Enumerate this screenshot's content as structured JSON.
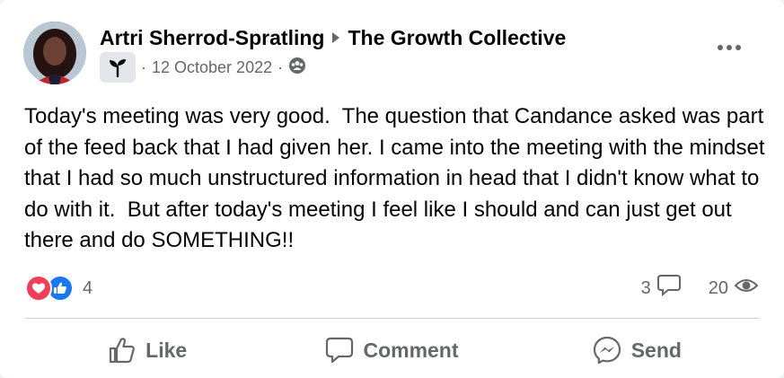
{
  "post": {
    "author": "Artri Sherrod-Spratling",
    "group": "The Growth Collective",
    "date": "12 October 2022",
    "body": "Today's meeting was very good.  The question that Candance asked was part of the feed back that I had given her. I came into the meeting with the mindset that I had so much unstructured information in head that I didn't know what to do with it.  But after today's meeting I feel like I should and can just get out there and do SOMETHING!!",
    "icons": {
      "more": "more-options-icon",
      "group": "sprout-icon",
      "audience": "group-audience-icon",
      "separator": "triangle-right-icon"
    }
  },
  "engagement": {
    "reactions_count": "4",
    "reaction_types": [
      "love",
      "like"
    ],
    "comments_count": "3",
    "views_count": "20"
  },
  "actions": {
    "like": "Like",
    "comment": "Comment",
    "send": "Send"
  },
  "colors": {
    "love": "#f33e58",
    "like": "#1877f2",
    "secondary_text": "#65676b",
    "primary_text": "#050505"
  }
}
